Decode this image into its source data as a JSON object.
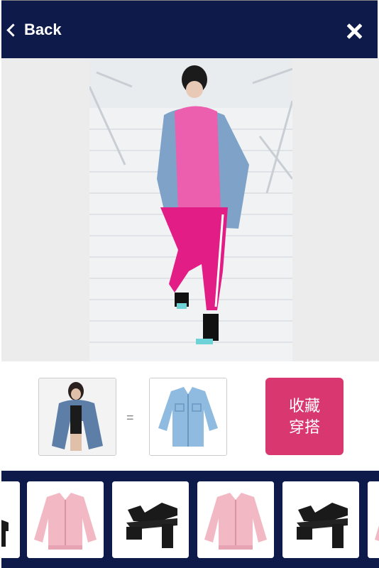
{
  "header": {
    "back_label": "Back",
    "close_icon": "close-icon"
  },
  "main_photo": {
    "icon": "outfit-photo"
  },
  "outfit": {
    "equals_sign": "=",
    "save_line1": "收藏",
    "save_line2": "穿搭"
  },
  "carousel": {
    "items": [
      {
        "type": "heel-sandal",
        "color": "#1a1a1a"
      },
      {
        "type": "pink-bomber-jacket",
        "color": "#f2b8c4"
      },
      {
        "type": "heel-sandal",
        "color": "#1a1a1a"
      },
      {
        "type": "pink-bomber-jacket",
        "color": "#f2b8c4"
      },
      {
        "type": "heel-sandal",
        "color": "#1a1a1a"
      },
      {
        "type": "pink-bomber-jacket",
        "color": "#f2b8c4"
      }
    ]
  },
  "colors": {
    "navy": "#0d1a4a",
    "accent_pink": "#d8386f"
  }
}
